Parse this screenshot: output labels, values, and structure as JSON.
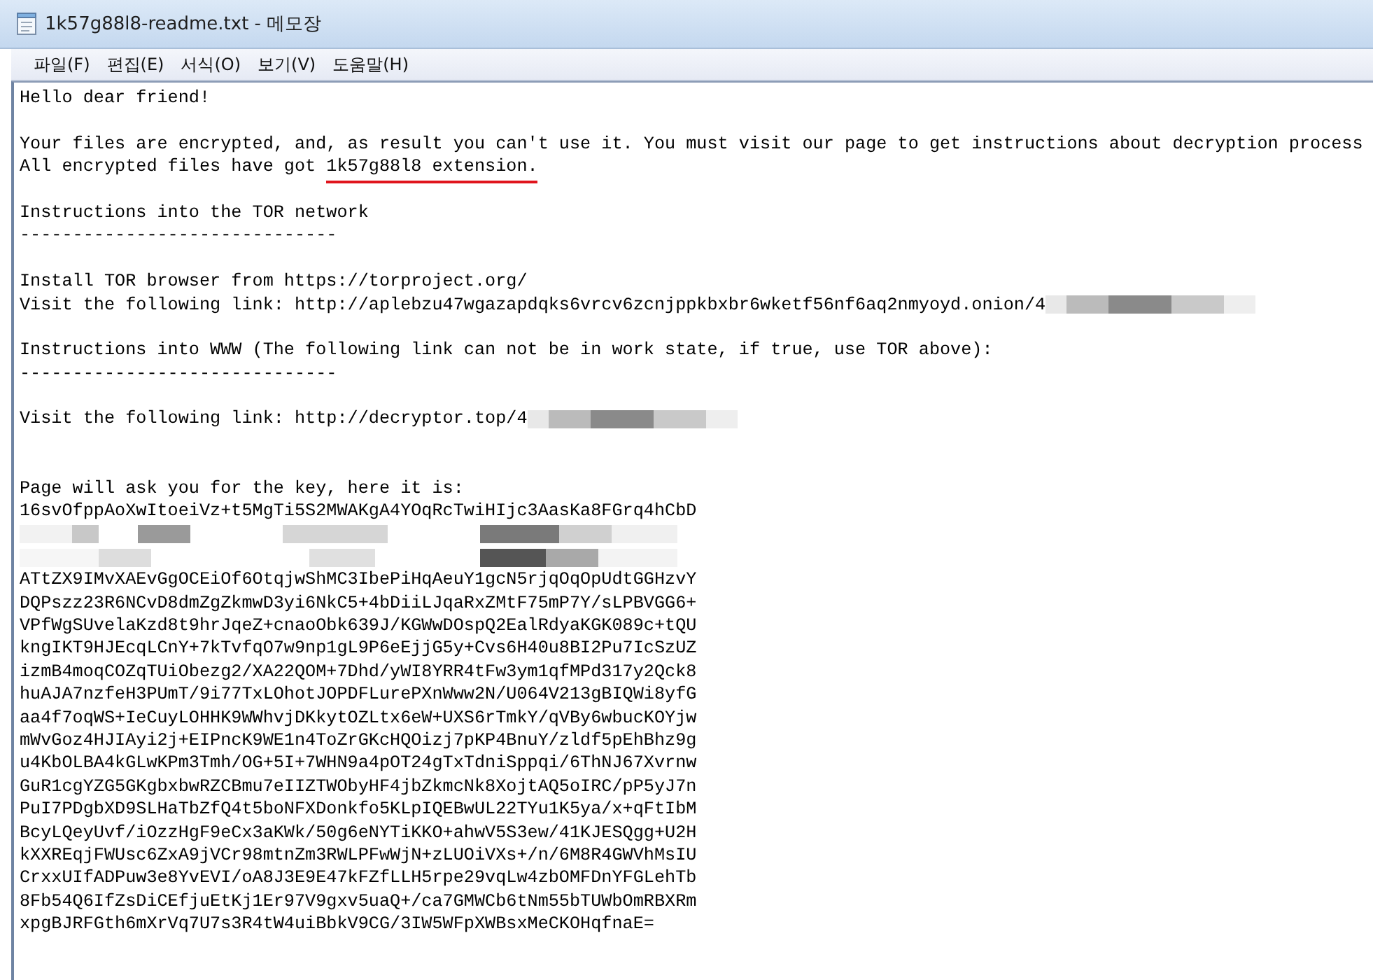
{
  "window": {
    "title": "1k57g88l8-readme.txt - 메모장"
  },
  "menu": [
    "파일(F)",
    "편집(E)",
    "서식(O)",
    "보기(V)",
    "도움말(H)"
  ],
  "lines": [
    {
      "kind": "text",
      "segments": [
        {
          "text": "Hello dear friend!"
        }
      ]
    },
    {
      "kind": "blank"
    },
    {
      "kind": "text",
      "segments": [
        {
          "text": "Your files are encrypted, and, as result you can't use it. You must visit our page to get instructions about decryption process"
        }
      ]
    },
    {
      "kind": "text",
      "segments": [
        {
          "text": "All encrypted files have got "
        },
        {
          "text": "1k57g88l8 extension.",
          "underlined": true
        }
      ]
    },
    {
      "kind": "blank"
    },
    {
      "kind": "text",
      "segments": [
        {
          "text": "Instructions into the TOR network"
        }
      ]
    },
    {
      "kind": "text",
      "segments": [
        {
          "text": "------------------------------"
        }
      ]
    },
    {
      "kind": "blank"
    },
    {
      "kind": "text",
      "segments": [
        {
          "text": "Install TOR browser from https://torproject.org/"
        }
      ]
    },
    {
      "kind": "text",
      "segments": [
        {
          "text": "Visit the following link: http://aplebzu47wgazapdqks6vrcv6zcnjppkbxbr6wketf56nf6aq2nmyoyd.onion/4"
        }
      ],
      "redacted_tail": true
    },
    {
      "kind": "blank"
    },
    {
      "kind": "text",
      "segments": [
        {
          "text": "Instructions into WWW (The following link can not be in work state, if true, use TOR above):"
        }
      ]
    },
    {
      "kind": "text",
      "segments": [
        {
          "text": "------------------------------"
        }
      ]
    },
    {
      "kind": "blank"
    },
    {
      "kind": "text",
      "segments": [
        {
          "text": "Visit the following link: http://decryptor.top/4"
        }
      ],
      "redacted_tail": true
    },
    {
      "kind": "blank"
    },
    {
      "kind": "blank"
    },
    {
      "kind": "text",
      "segments": [
        {
          "text": "Page will ask you for the key, here it is:"
        }
      ]
    },
    {
      "kind": "text",
      "segments": [
        {
          "text": "16svOfppAoXwItoeiVz+t5MgTi5S2MWAKgA4YOqRcTwiHIjc3AasKa8FGrq4hCbD"
        }
      ]
    },
    {
      "kind": "redacted"
    },
    {
      "kind": "redacted"
    },
    {
      "kind": "text",
      "segments": [
        {
          "text": "ATtZX9IMvXAEvGgOCEiOf6OtqjwShMC3IbePiHqAeuY1gcN5rjqOqOpUdtGGHzvY"
        }
      ]
    },
    {
      "kind": "text",
      "segments": [
        {
          "text": "DQPszz23R6NCvD8dmZgZkmwD3yi6NkC5+4bDiiLJqaRxZMtF75mP7Y/sLPBVGG6+"
        }
      ]
    },
    {
      "kind": "text",
      "segments": [
        {
          "text": "VPfWgSUvelaKzd8t9hrJqeZ+cnaoObk639J/KGWwDOspQ2EalRdyaKGK089c+tQU"
        }
      ]
    },
    {
      "kind": "text",
      "segments": [
        {
          "text": "kngIKT9HJEcqLCnY+7kTvfqO7w9np1gL9P6eEjjG5y+Cvs6H40u8BI2Pu7IcSzUZ"
        }
      ]
    },
    {
      "kind": "text",
      "segments": [
        {
          "text": "izmB4moqCOZqTUiObezg2/XA22QOM+7Dhd/yWI8YRR4tFw3ym1qfMPd317y2Qck8"
        }
      ]
    },
    {
      "kind": "text",
      "segments": [
        {
          "text": "huAJA7nzfeH3PUmT/9i77TxLOhotJOPDFLurePXnWww2N/U064V213gBIQWi8yfG"
        }
      ]
    },
    {
      "kind": "text",
      "segments": [
        {
          "text": "aa4f7oqWS+IeCuyLOHHK9WWhvjDKkytOZLtx6eW+UXS6rTmkY/qVBy6wbucKOYjw"
        }
      ]
    },
    {
      "kind": "text",
      "segments": [
        {
          "text": "mWvGoz4HJIAyi2j+EIPncK9WE1n4ToZrGKcHQOizj7pKP4BnuY/zldf5pEhBhz9g"
        }
      ]
    },
    {
      "kind": "text",
      "segments": [
        {
          "text": "u4KbOLBA4kGLwKPm3Tmh/OG+5I+7WHN9a4pOT24gTxTdniSppqi/6ThNJ67Xvrnw"
        }
      ]
    },
    {
      "kind": "text",
      "segments": [
        {
          "text": "GuR1cgYZG5GKgbxbwRZCBmu7eIIZTWObyHF4jbZkmcNk8XojtAQ5oIRC/pP5yJ7n"
        }
      ]
    },
    {
      "kind": "text",
      "segments": [
        {
          "text": "PuI7PDgbXD9SLHaTbZfQ4t5boNFXDonkfo5KLpIQEBwUL22TYu1K5ya/x+qFtIbM"
        }
      ]
    },
    {
      "kind": "text",
      "segments": [
        {
          "text": "BcyLQeyUvf/iOzzHgF9eCx3aKWk/50g6eNYTiKKO+ahwV5S3ew/41KJESQgg+U2H"
        }
      ]
    },
    {
      "kind": "text",
      "segments": [
        {
          "text": "kXXREqjFWUsc6ZxA9jVCr98mtnZm3RWLPFwWjN+zLUOiVXs+/n/6M8R4GWVhMsIU"
        }
      ]
    },
    {
      "kind": "text",
      "segments": [
        {
          "text": "CrxxUIfADPuw3e8YvEVI/oA8J3E9E47kFZfLLH5rpe29vqLw4zbOMFDnYFGLehTb"
        }
      ]
    },
    {
      "kind": "text",
      "segments": [
        {
          "text": "8Fb54Q6IfZsDiCEfjuEtKj1Er97V9gxv5uaQ+/ca7GMWCb6tNm55bTUWbOmRBXRm"
        }
      ]
    },
    {
      "kind": "text",
      "segments": [
        {
          "text": "xpgBJRFGth6mXrVq7U7s3R4tW4uiBbkV9CG/3IW5WFpXWBsxMeCKOHqfnaE="
        }
      ]
    }
  ]
}
